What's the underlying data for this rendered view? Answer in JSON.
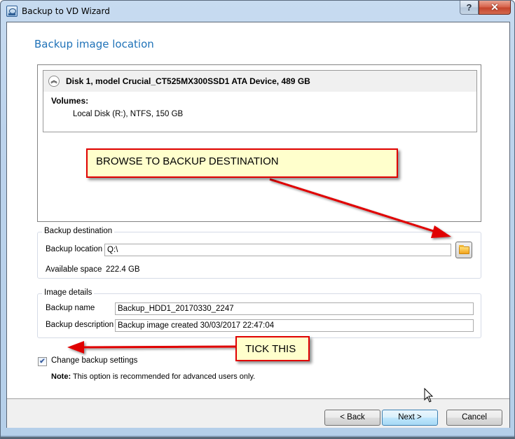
{
  "window": {
    "title": "Backup to VD Wizard",
    "help_glyph": "?",
    "close_glyph": "✕"
  },
  "page": {
    "title": "Backup image location"
  },
  "disk": {
    "collapse_glyph": "︽",
    "title": "Disk 1, model Crucial_CT525MX300SSD1 ATA Device, 489 GB",
    "volumes_label": "Volumes:",
    "volumes": [
      "Local Disk (R:), NTFS, 150 GB"
    ]
  },
  "backup_destination": {
    "legend": "Backup destination",
    "location_label": "Backup location",
    "location_value": "Q:\\",
    "available_label": "Available space",
    "available_value": "222.4 GB",
    "browse_icon": "folder-icon"
  },
  "image_details": {
    "legend": "Image details",
    "name_label": "Backup name",
    "name_value": "Backup_HDD1_20170330_2247",
    "description_label": "Backup description",
    "description_value": "Backup image created 30/03/2017 22:47:04"
  },
  "options": {
    "change_settings_label": "Change backup settings",
    "change_settings_checked": true,
    "check_glyph": "✔",
    "note_bold": "Note:",
    "note_text": " This option is recommended for advanced users only."
  },
  "footer": {
    "back_label": "< Back",
    "next_label": "Next >",
    "cancel_label": "Cancel"
  },
  "annotations": {
    "browse_callout": "BROWSE TO BACKUP DESTINATION",
    "tick_callout": "TICK THIS",
    "arrow_color": "#e00000",
    "callout_bg": "#ffffcc"
  },
  "colors": {
    "title_blue": "#1f72b8",
    "close_red": "#c4452d"
  }
}
